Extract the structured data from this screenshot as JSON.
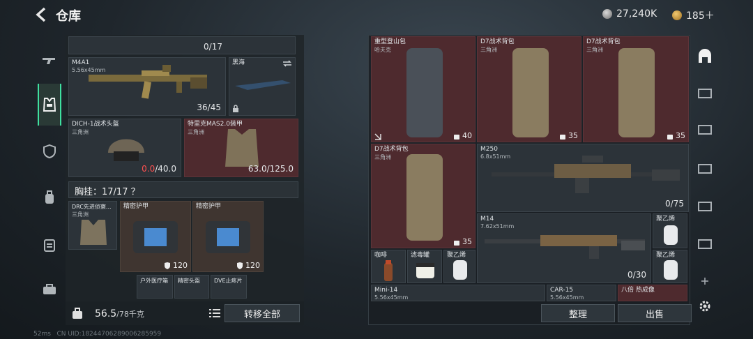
{
  "header": {
    "title": "仓库",
    "currency1": "27,240K",
    "currency2": "185＋"
  },
  "nav": {
    "items": [
      {
        "name": "weapons",
        "icon": "gun-icon"
      },
      {
        "name": "gear",
        "icon": "vest-icon"
      },
      {
        "name": "armor",
        "icon": "shield-icon"
      },
      {
        "name": "bag",
        "icon": "backpack-icon"
      },
      {
        "name": "medical",
        "icon": "medkit-icon"
      },
      {
        "name": "misc",
        "icon": "briefcase-icon"
      }
    ]
  },
  "left": {
    "top_slot_value": "0/17",
    "weapon": {
      "name": "M4A1",
      "caliber": "5.56x45mm",
      "ammo": "36/45"
    },
    "skin": {
      "name": "黑海"
    },
    "helmet": {
      "name": "DICH-1战术头盔",
      "region": "三角洲",
      "dur_current": "0.0",
      "dur_max": "/40.0"
    },
    "armor": {
      "name": "特里克MAS2.0装甲",
      "region": "三角洲",
      "durability": "63.0/125.0"
    },
    "chest": {
      "label": "胸挂：17/17 ？"
    },
    "rig": {
      "name": "DRC先进侦察...",
      "region": "三角洲"
    },
    "case1": {
      "name": "精密护甲",
      "value": "120"
    },
    "case2": {
      "name": "精密护甲",
      "value": "120"
    },
    "mini1": "户外医疗箱",
    "mini2": "精密头盔",
    "mini3": "DVE止疼片",
    "weight_current": "56.5",
    "weight_max": "/78千克",
    "transfer_all": "转移全部"
  },
  "right": {
    "items": [
      {
        "name": "重型登山包",
        "region": "哈夫克",
        "count": "40"
      },
      {
        "name": "D7战术背包",
        "region": "三角洲",
        "count": "35"
      },
      {
        "name": "D7战术背包",
        "region": "三角洲",
        "count": "35"
      },
      {
        "name": "D7战术背包",
        "region": "三角洲",
        "count": "35"
      }
    ],
    "m250": {
      "name": "M250",
      "caliber": "6.8x51mm",
      "ammo": "0/75"
    },
    "m14": {
      "name": "M14",
      "caliber": "7.62x51mm",
      "ammo": "0/30"
    },
    "small1": "咖啡",
    "small2": "滤毒罐",
    "small3": "聚乙烯",
    "small4": "聚乙烯",
    "small5": "聚乙烯",
    "mini14": {
      "name": "Mini-14",
      "caliber": "5.56x45mm"
    },
    "car15": {
      "name": "CAR-15",
      "caliber": "5.56x45mm"
    },
    "scope": "八倍 热成像",
    "sort_btn": "整理",
    "sell_btn": "出售"
  },
  "footer": {
    "ping": "52ms",
    "uid": "CN UID:18244706289006285959"
  }
}
